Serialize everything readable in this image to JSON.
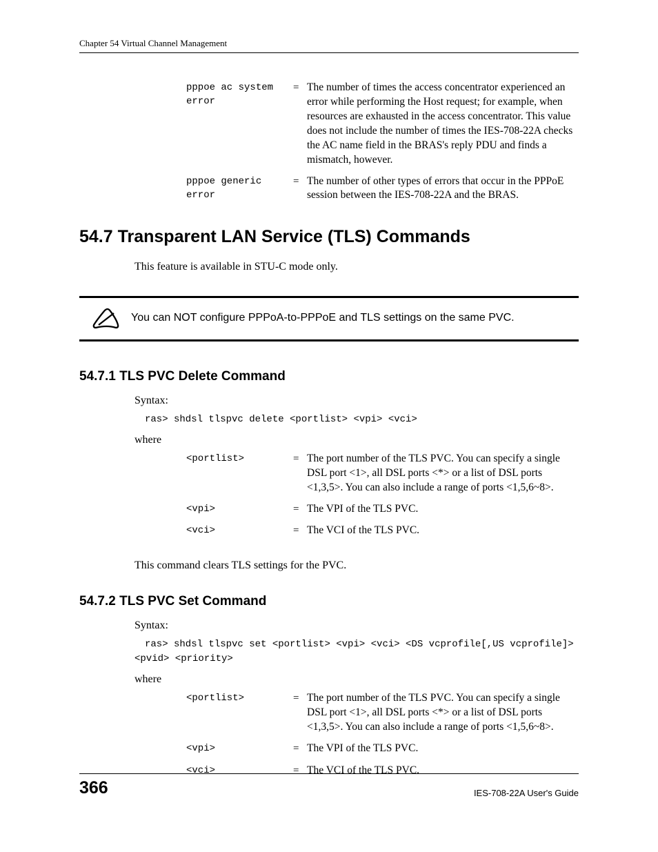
{
  "chapter_header": "Chapter 54 Virtual Channel Management",
  "top_defs": [
    {
      "term": "pppoe ac system error",
      "eq": "=",
      "desc": "The number of times the access concentrator experienced an error while performing the Host request; for example, when resources are exhausted in the access concentrator. This value does not include the number of times the IES-708-22A checks the AC name field in the BRAS's reply PDU and finds a mismatch, however."
    },
    {
      "term": "pppoe generic error",
      "eq": "=",
      "desc": "The number of other types of errors that occur in the PPPoE session between the IES-708-22A and the BRAS."
    }
  ],
  "section_547": {
    "heading": "54.7  Transparent LAN Service (TLS) Commands",
    "intro": "This feature is available in STU-C mode only.",
    "note": "You can NOT configure PPPoA-to-PPPoE and TLS settings on the same PVC."
  },
  "section_5471": {
    "heading": "54.7.1  TLS PVC Delete Command",
    "syntax_label": "Syntax:",
    "code": "ras> shdsl tlspvc delete <portlist> <vpi> <vci>",
    "where_label": "where",
    "defs": [
      {
        "term": "<portlist>",
        "eq": "=",
        "desc": "The port number of the TLS PVC. You can specify a single DSL port <1>, all DSL ports <*> or a list of DSL ports <1,3,5>. You can also include a range of ports <1,5,6~8>."
      },
      {
        "term": "<vpi>",
        "eq": "=",
        "desc": "The VPI of the TLS PVC."
      },
      {
        "term": "<vci>",
        "eq": "=",
        "desc": "The VCI of the TLS PVC."
      }
    ],
    "closing": "This command clears TLS settings for the PVC."
  },
  "section_5472": {
    "heading": "54.7.2  TLS PVC Set Command",
    "syntax_label": "Syntax:",
    "code_line1": "ras> shdsl tlspvc set <portlist> <vpi> <vci> <DS vcprofile[,US vcprofile]>",
    "code_line2": "<pvid> <priority>",
    "where_label": "where",
    "defs": [
      {
        "term": "<portlist>",
        "eq": "=",
        "desc": "The port number of the TLS PVC. You can specify a single DSL port <1>, all DSL ports <*> or a list of DSL ports <1,3,5>. You can also include a range of ports <1,5,6~8>."
      },
      {
        "term": "<vpi>",
        "eq": "=",
        "desc": "The VPI of the TLS PVC."
      },
      {
        "term": "<vci>",
        "eq": "=",
        "desc": "The VCI of the TLS PVC."
      }
    ]
  },
  "footer": {
    "page": "366",
    "guide": "IES-708-22A User's Guide"
  }
}
